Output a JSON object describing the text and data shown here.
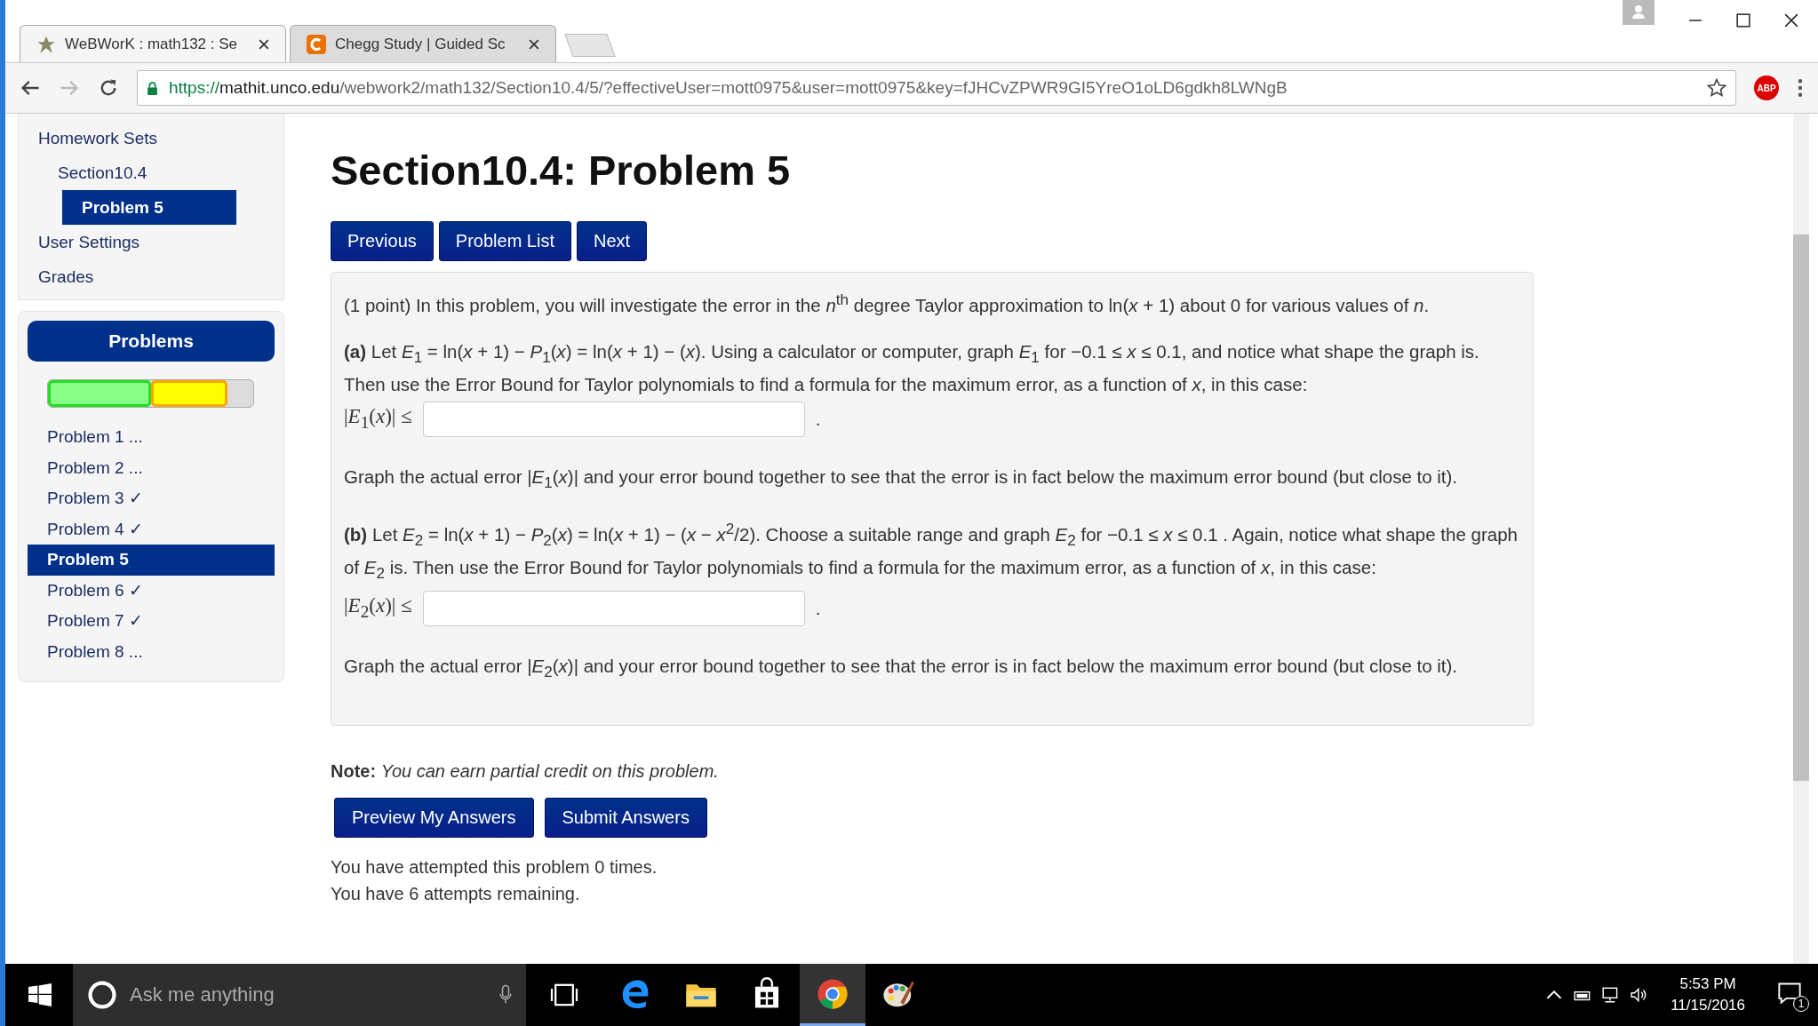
{
  "browser": {
    "tabs": [
      {
        "title": "WeBWorK : math132 : Se",
        "selected": true,
        "kind": "webwork"
      },
      {
        "title": "Chegg Study | Guided Sc",
        "selected": false,
        "kind": "chegg"
      }
    ],
    "url": {
      "scheme": "https://",
      "host": "mathit.unco.edu",
      "path": "/webwork2/math132/Section10.4/5/?effectiveUser=mott0975&user=mott0975&key=fJHCvZPWR9GI5YreO1oLD6gdkh8LWNgB"
    },
    "extension_badge": "ABP"
  },
  "sidebar": {
    "nav": [
      {
        "label": "Homework Sets",
        "selected": false,
        "children": [
          {
            "label": "Section10.4",
            "selected": false,
            "children": [
              {
                "label": "Problem 5",
                "selected": true
              }
            ]
          }
        ]
      },
      {
        "label": "User Settings",
        "selected": false
      },
      {
        "label": "Grades",
        "selected": false
      }
    ],
    "problems_header": "Problems",
    "progress": [
      {
        "kind": "correct"
      },
      {
        "kind": "partial"
      }
    ],
    "problems": [
      {
        "label": "Problem 1 ...",
        "selected": false
      },
      {
        "label": "Problem 2 ...",
        "selected": false
      },
      {
        "label": "Problem 3 ✓",
        "selected": false
      },
      {
        "label": "Problem 4 ✓",
        "selected": false
      },
      {
        "label": "Problem 5",
        "selected": true
      },
      {
        "label": "Problem 6 ✓",
        "selected": false
      },
      {
        "label": "Problem 7 ✓",
        "selected": false
      },
      {
        "label": "Problem 8 ...",
        "selected": false
      }
    ]
  },
  "main": {
    "title": "Section10.4: Problem 5",
    "nav_buttons": [
      "Previous",
      "Problem List",
      "Next"
    ],
    "problem": [
      {
        "kind": "text",
        "text": "(1 point) In this problem, you will investigate the error in the *n*$^{th}$ degree Taylor approximation to ln(*x* + 1) about 0 for various values of *n*."
      },
      {
        "kind": "text",
        "text": "**(a)** Let *E*$_{1}$ = ln(*x* + 1) − *P*$_{1}$(*x*) = ln(*x* + 1) − (*x*). Using a calculator or computer, graph *E*$_{1}$ for −0.1 ≤ *x* ≤ 0.1, and notice what shape the graph is. Then use the Error Bound for Taylor polynomials to find a formula for the maximum error, as a function of *x*, in this case:"
      },
      {
        "kind": "answer",
        "label": "|*E*$_{1}$(*x*)| ≤",
        "after": "."
      },
      {
        "kind": "text",
        "text": "Graph the actual error |*E*$_{1}$(*x*)| and your error bound together to see that the error is in fact below the maximum error bound (but close to it)."
      },
      {
        "kind": "text",
        "text": "**(b)** Let *E*$_{2}$ = ln(*x* + 1) − *P*$_{2}$(*x*) = ln(*x* + 1) − (*x* − *x*$^{2}$/2). Choose a suitable range and graph *E*$_{2}$ for −0.1 ≤ *x* ≤ 0.1 . Again, notice what shape the graph of *E*$_{2}$ is. Then use the Error Bound for Taylor polynomials to find a formula for the maximum error, as a function of *x*, in this case:"
      },
      {
        "kind": "answer",
        "label": "|*E*$_{2}$(*x*)| ≤",
        "after": "."
      },
      {
        "kind": "text",
        "text": "Graph the actual error |*E*$_{2}$(*x*)| and your error bound together to see that the error is in fact below the maximum error bound (but close to it)."
      }
    ],
    "note_label": "Note:",
    "note": "You can earn partial credit on this problem.",
    "submit_buttons": [
      "Preview My Answers",
      "Submit Answers"
    ],
    "attempts": [
      "You have attempted this problem 0 times.",
      "You have 6 attempts remaining."
    ]
  },
  "taskbar": {
    "search_placeholder": "Ask me anything",
    "apps": [
      {
        "kind": "edge",
        "selected": false
      },
      {
        "kind": "folder",
        "selected": false
      },
      {
        "kind": "store",
        "selected": false
      },
      {
        "kind": "chrome",
        "selected": true
      },
      {
        "kind": "paint",
        "selected": false
      }
    ],
    "time": "5:53 PM",
    "date": "11/15/2016",
    "notifications": "1"
  }
}
